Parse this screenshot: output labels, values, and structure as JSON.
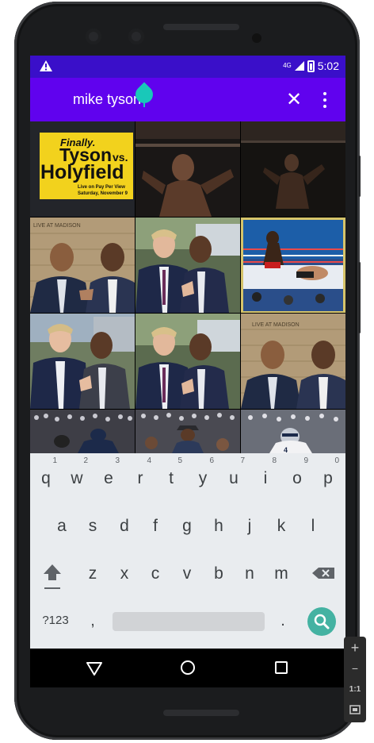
{
  "status_bar": {
    "time": "5:02",
    "network_type": "4G",
    "warning_icon": "warning-icon",
    "signal_icon": "signal-icon",
    "battery_icon": "battery-icon"
  },
  "app_bar": {
    "background_color": "#6002ee",
    "search_query": "mike tyson",
    "clear_icon": "close-icon",
    "more_icon": "more-vert-icon"
  },
  "image_grid": {
    "images": [
      {
        "name": "tyson-vs-holyfield-poster",
        "text_lines": [
          "Finally.",
          "Tyson",
          "vs.",
          "Holyfield",
          "Live on Pay Per View",
          "Saturday, November 9"
        ]
      },
      {
        "name": "tyson-training-shadow-1"
      },
      {
        "name": "tyson-training-shadow-2"
      },
      {
        "name": "tyson-with-man-brick-wall-1"
      },
      {
        "name": "trump-and-tyson-1"
      },
      {
        "name": "boxing-ring-fight"
      },
      {
        "name": "trump-and-tyson-2"
      },
      {
        "name": "trump-and-tyson-3"
      },
      {
        "name": "tyson-with-man-brick-wall-2"
      },
      {
        "name": "stadium-crowd-1"
      },
      {
        "name": "stadium-crowd-2"
      },
      {
        "name": "football-player"
      }
    ]
  },
  "keyboard": {
    "row1": [
      {
        "key": "q",
        "hint": "1"
      },
      {
        "key": "w",
        "hint": "2"
      },
      {
        "key": "e",
        "hint": "3"
      },
      {
        "key": "r",
        "hint": "4"
      },
      {
        "key": "t",
        "hint": "5"
      },
      {
        "key": "y",
        "hint": "6"
      },
      {
        "key": "u",
        "hint": "7"
      },
      {
        "key": "i",
        "hint": "8"
      },
      {
        "key": "o",
        "hint": "9"
      },
      {
        "key": "p",
        "hint": "0"
      }
    ],
    "row2": [
      "a",
      "s",
      "d",
      "f",
      "g",
      "h",
      "j",
      "k",
      "l"
    ],
    "row3": [
      "z",
      "x",
      "c",
      "v",
      "b",
      "n",
      "m"
    ],
    "symbols_label": "?123",
    "comma": ",",
    "period": ".",
    "shift_icon": "shift-icon",
    "backspace_icon": "backspace-icon",
    "search_icon": "search-icon",
    "search_key_color": "#44b2a2"
  },
  "nav_bar": {
    "back_icon": "nav-back-icon",
    "home_icon": "nav-home-icon",
    "recents_icon": "nav-recents-icon"
  },
  "emulator_toolbar": {
    "zoom_in": "+",
    "zoom_out": "−",
    "ratio": "1:1",
    "fit_icon": "fit-screen-icon"
  }
}
